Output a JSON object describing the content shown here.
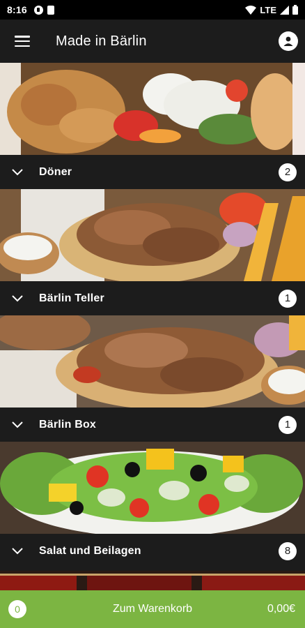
{
  "status_bar": {
    "time": "8:16",
    "network": "LTE",
    "icons": [
      "pocket-casts-icon",
      "sd-card-icon",
      "wifi-icon",
      "signal-icon",
      "battery-icon"
    ]
  },
  "app_bar": {
    "title": "Made in Bärlin",
    "menu_icon": "hamburger-menu-icon",
    "account_icon": "account-icon"
  },
  "categories": [
    {
      "label": "Döner",
      "count": "2",
      "icon": "chevron-down-icon"
    },
    {
      "label": "Bärlin Teller",
      "count": "1",
      "icon": "chevron-down-icon"
    },
    {
      "label": "Bärlin Box",
      "count": "1",
      "icon": "chevron-down-icon"
    },
    {
      "label": "Salat und Beilagen",
      "count": "8",
      "icon": "chevron-down-icon"
    }
  ],
  "cart": {
    "count": "0",
    "label": "Zum Warenkorb",
    "total": "0,00€"
  },
  "colors": {
    "background": "#1c1c1c",
    "accent_green": "#7cb542",
    "status_bar": "#000000"
  }
}
